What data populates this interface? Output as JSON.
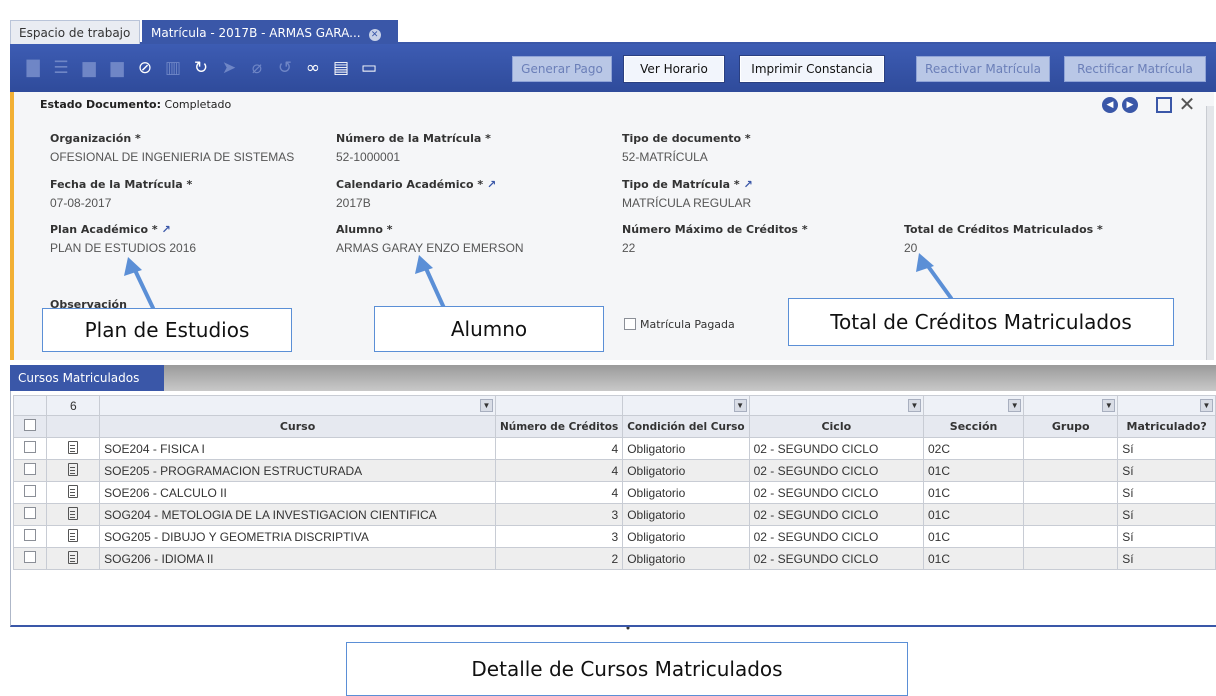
{
  "tabs": [
    {
      "label": "Espacio de trabajo"
    },
    {
      "label": "Matrícula - 2017B - ARMAS GARA..."
    }
  ],
  "toolbar": {
    "icons": [
      "new-icon",
      "grid-icon",
      "save-icon",
      "save-new-icon",
      "cancel-icon",
      "delete-icon",
      "refresh-icon",
      "export-icon",
      "attach-icon",
      "history-icon",
      "link-icon",
      "report-icon",
      "window-icon"
    ],
    "buttons": {
      "generar_pago": "Generar Pago",
      "ver_horario": "Ver Horario",
      "imprimir_constancia": "Imprimir Constancia",
      "reactivar_matricula": "Reactivar Matrícula",
      "rectificar_matricula": "Rectificar Matrícula"
    }
  },
  "form": {
    "status_label": "Estado Documento:",
    "status_value": "Completado",
    "organizacion": {
      "label": "Organización *",
      "value": "OFESIONAL DE INGENIERIA DE SISTEMAS"
    },
    "numero_matricula": {
      "label": "Número de la Matrícula *",
      "value": "52-1000001"
    },
    "tipo_documento": {
      "label": "Tipo de documento *",
      "value": "52-MATRÍCULA"
    },
    "fecha_matricula": {
      "label": "Fecha de la Matrícula *",
      "value": "07-08-2017"
    },
    "calendario_academico": {
      "label": "Calendario Académico *",
      "value": "2017B"
    },
    "tipo_matricula": {
      "label": "Tipo de Matrícula *",
      "value": "MATRÍCULA REGULAR"
    },
    "plan_academico": {
      "label": "Plan Académico *",
      "value": "PLAN DE ESTUDIOS 2016"
    },
    "alumno": {
      "label": "Alumno *",
      "value": "ARMAS GARAY ENZO EMERSON"
    },
    "max_creditos": {
      "label": "Número Máximo de Créditos *",
      "value": "22"
    },
    "total_creditos": {
      "label": "Total de Créditos Matriculados *",
      "value": "20"
    },
    "observacion_label": "Observación",
    "matricula_pagada": "Matrícula Pagada"
  },
  "callouts": {
    "plan": "Plan de Estudios",
    "alumno": "Alumno",
    "total": "Total de Créditos Matriculados",
    "detalle": "Detalle de Cursos Matriculados"
  },
  "grid": {
    "tab_label": "Cursos Matriculados",
    "row_count": "6",
    "columns": [
      "Curso",
      "Número de Créditos",
      "Condición del Curso",
      "Ciclo",
      "Sección",
      "Grupo",
      "Matriculado?"
    ],
    "rows": [
      {
        "curso": "SOE204 - FISICA I",
        "creditos": "4",
        "condicion": "Obligatorio",
        "ciclo": "02 - SEGUNDO CICLO",
        "seccion": "02C",
        "grupo": "",
        "matriculado": "Sí"
      },
      {
        "curso": "SOE205 - PROGRAMACION ESTRUCTURADA",
        "creditos": "4",
        "condicion": "Obligatorio",
        "ciclo": "02 - SEGUNDO CICLO",
        "seccion": "01C",
        "grupo": "",
        "matriculado": "Sí"
      },
      {
        "curso": "SOE206 - CALCULO II",
        "creditos": "4",
        "condicion": "Obligatorio",
        "ciclo": "02 - SEGUNDO CICLO",
        "seccion": "01C",
        "grupo": "",
        "matriculado": "Sí"
      },
      {
        "curso": "SOG204 - METOLOGIA DE LA INVESTIGACION CIENTIFICA",
        "creditos": "3",
        "condicion": "Obligatorio",
        "ciclo": "02 - SEGUNDO CICLO",
        "seccion": "01C",
        "grupo": "",
        "matriculado": "Sí"
      },
      {
        "curso": "SOG205 - DIBUJO Y GEOMETRIA DISCRIPTIVA",
        "creditos": "3",
        "condicion": "Obligatorio",
        "ciclo": "02 - SEGUNDO CICLO",
        "seccion": "01C",
        "grupo": "",
        "matriculado": "Sí"
      },
      {
        "curso": "SOG206 - IDIOMA II",
        "creditos": "2",
        "condicion": "Obligatorio",
        "ciclo": "02 - SEGUNDO CICLO",
        "seccion": "01C",
        "grupo": "",
        "matriculado": "Sí"
      }
    ]
  },
  "colors": {
    "accent": "#3a57a8",
    "callout_border": "#5b8fd6",
    "arrow": "#5b8fd6",
    "form_edge": "#f2b035"
  }
}
